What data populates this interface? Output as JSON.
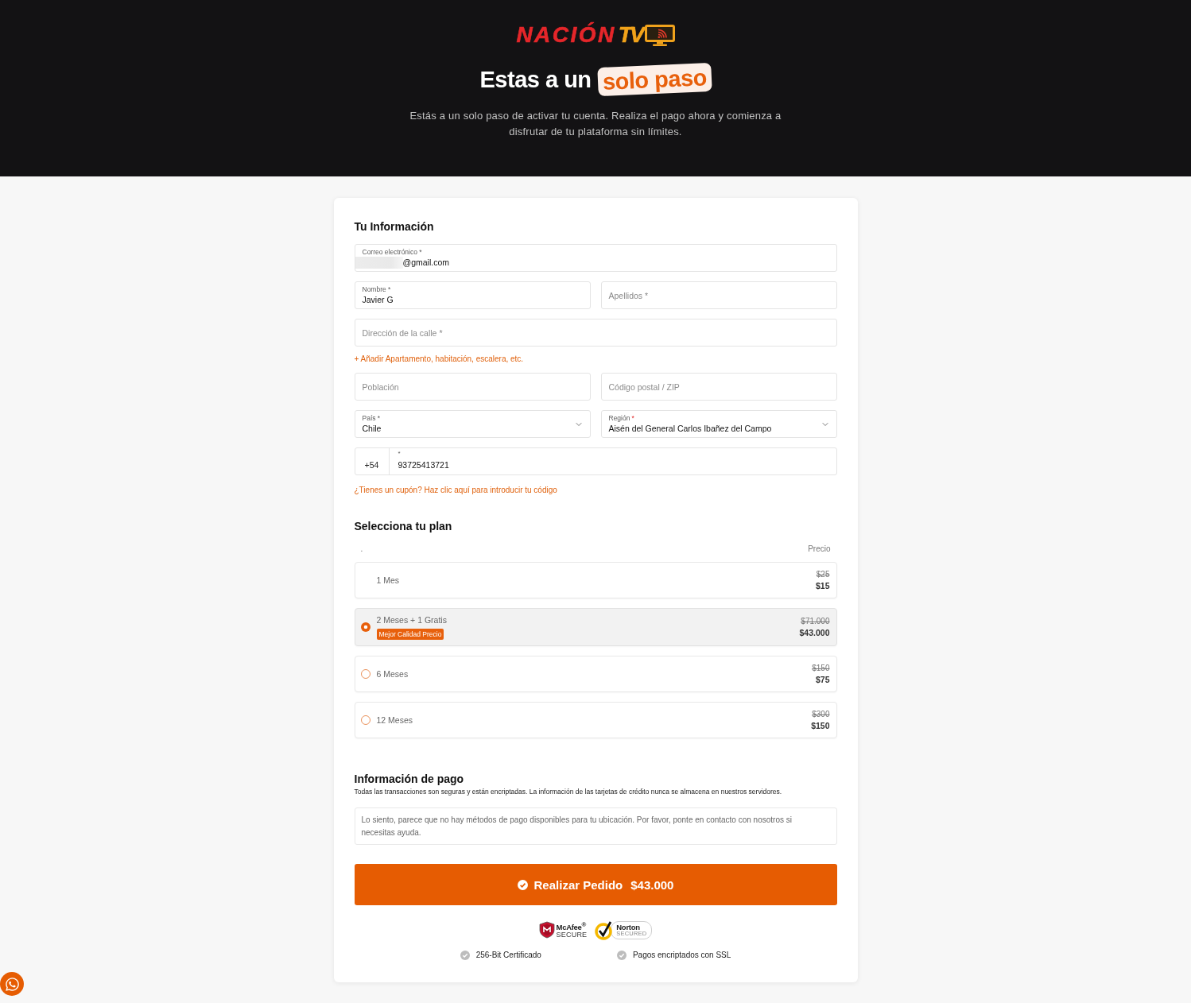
{
  "header": {
    "logo": {
      "name": "NACIÓN",
      "suffix": "TV"
    },
    "title": "Estas a un",
    "title_highlight": "solo paso",
    "subtitle": "Estás a un solo paso de activar tu cuenta. Realiza el pago ahora y comienza a disfrutar de tu plataforma sin límites."
  },
  "your_info": {
    "title": "Tu Información",
    "email": {
      "label": "Correo electrónico *",
      "value": "@gmail.com",
      "redacted": true
    },
    "first_name": {
      "label": "Nombre *",
      "value": "Javier G"
    },
    "last_name": {
      "placeholder": "Apellidos *"
    },
    "street": {
      "placeholder": "Dirección de la calle *"
    },
    "add_line_link": "+ Añadir Apartamento, habitación, escalera, etc.",
    "city": {
      "placeholder": "Población"
    },
    "postcode": {
      "placeholder": "Código postal / ZIP"
    },
    "country": {
      "label": "País *",
      "value": "Chile"
    },
    "region": {
      "label": "Región",
      "required_mark": "*",
      "value": "Aisén del General Carlos Ibañez del Campo"
    },
    "phone": {
      "prefix": "+54",
      "label": "*",
      "value": "93725413721"
    },
    "coupon_link": "¿Tienes un cupón? Haz clic aquí para introducir tu código"
  },
  "plan": {
    "title": "Selecciona tu plan",
    "column_1": ".",
    "price_header": "Precio",
    "options": [
      {
        "kind": "plain",
        "name": "1 Mes",
        "selected": false,
        "old_price": "$25",
        "price": "$15"
      },
      {
        "kind": "radio",
        "name": "2 Meses + 1 Gratis",
        "selected": true,
        "badge": "Mejor Calidad Precio",
        "old_price": "$71.000",
        "price": "$43.000"
      },
      {
        "kind": "radio",
        "name": "6 Meses",
        "selected": false,
        "old_price": "$150",
        "price": "$75"
      },
      {
        "kind": "radio",
        "name": "12 Meses",
        "selected": false,
        "old_price": "$300",
        "price": "$150"
      }
    ]
  },
  "payment": {
    "title": "Información de pago",
    "description": "Todas las transacciones son seguras y están encriptadas. La información de las tarjetas de crédito nunca se almacena en nuestros servidores.",
    "notice": "Lo siento, parece que no hay métodos de pago disponibles para tu ubicación. Por favor, ponte en contacto con nosotros si necesitas ayuda."
  },
  "order_button": {
    "label": "Realizar Pedido",
    "amount": "$43.000"
  },
  "security": {
    "badges": [
      {
        "kind": "shield",
        "name": "McAfee$^{®}$",
        "caption": "SECURE"
      },
      {
        "kind": "seal",
        "name": "Norton",
        "caption": "SECURED"
      }
    ],
    "features": [
      "256-Bit Certificado",
      "Pagos encriptados con SSL"
    ]
  }
}
